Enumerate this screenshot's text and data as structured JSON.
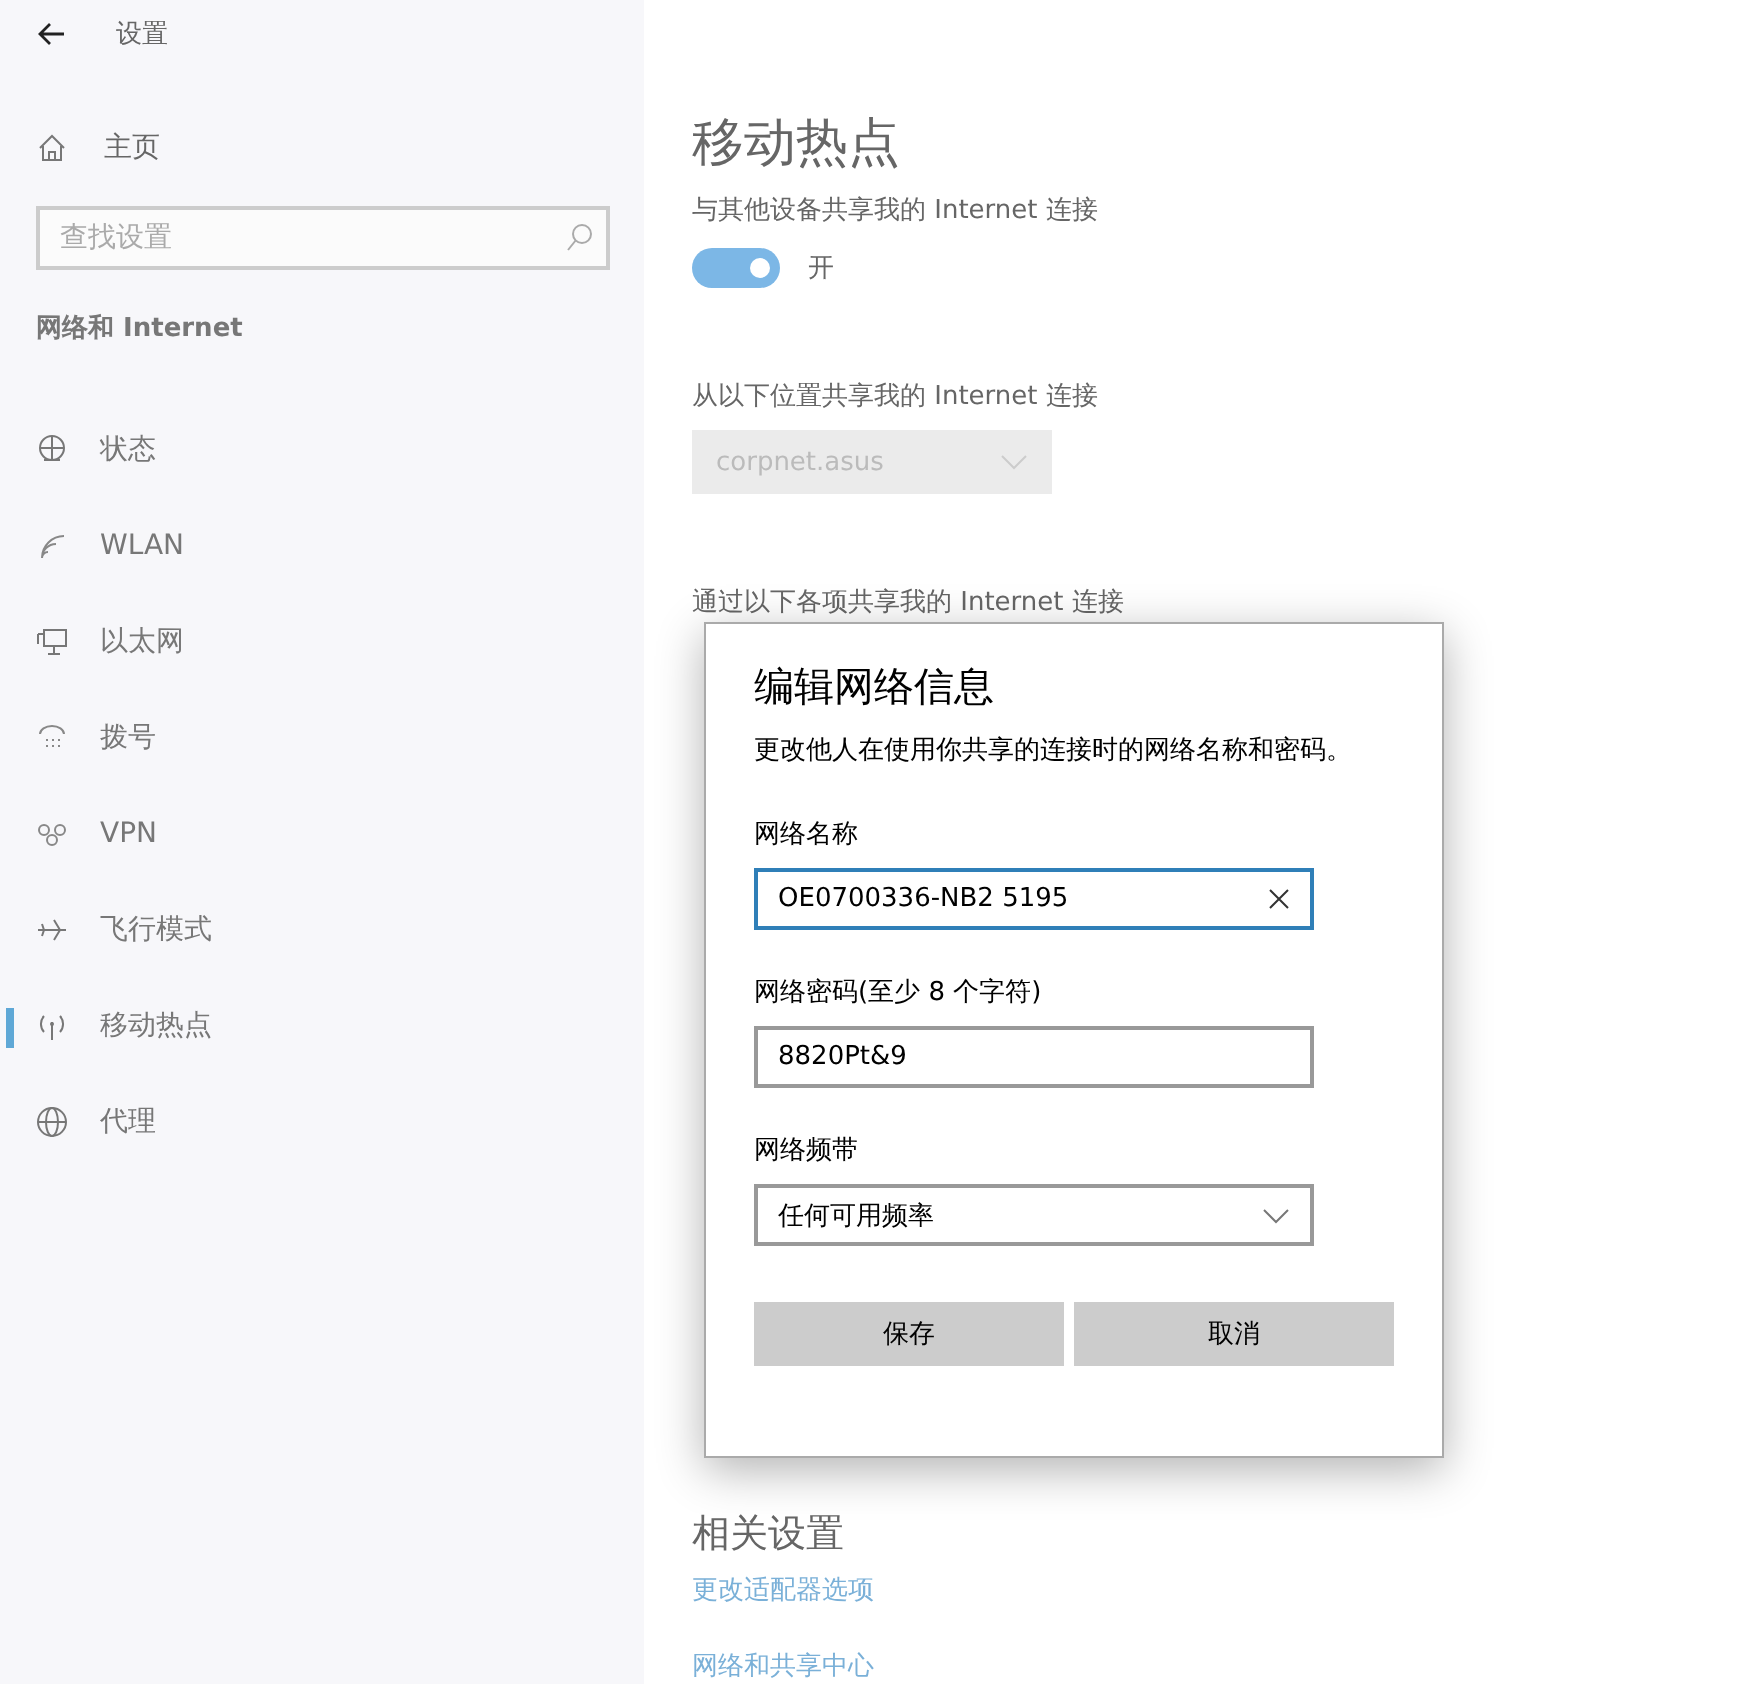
{
  "window": {
    "title": "设置"
  },
  "sidebar": {
    "home": "主页",
    "search": {
      "placeholder": "查找设置"
    },
    "section": "网络和 Internet",
    "items": [
      {
        "label": "状态",
        "selected": false
      },
      {
        "label": "WLAN",
        "selected": false
      },
      {
        "label": "以太网",
        "selected": false
      },
      {
        "label": "拨号",
        "selected": false
      },
      {
        "label": "VPN",
        "selected": false
      },
      {
        "label": "飞行模式",
        "selected": false
      },
      {
        "label": "移动热点",
        "selected": true
      },
      {
        "label": "代理",
        "selected": false
      }
    ]
  },
  "main": {
    "title": "移动热点",
    "share": {
      "label": "与其他设备共享我的 Internet 连接",
      "toggle": {
        "on": true,
        "label": "开"
      }
    },
    "source": {
      "label": "从以下位置共享我的 Internet 连接",
      "dropdown": {
        "value": "corpnet.asus",
        "disabled": true
      }
    },
    "via": {
      "label": "通过以下各项共享我的 Internet 连接"
    },
    "related": {
      "title": "相关设置",
      "links": [
        "更改适配器选项",
        "网络和共享中心"
      ]
    }
  },
  "dialog": {
    "title": "编辑网络信息",
    "description": "更改他人在使用你共享的连接时的网络名称和密码。",
    "fields": [
      {
        "kind": "text",
        "label": "网络名称",
        "value": "OE0700336-NB2 5195",
        "focused": true
      },
      {
        "kind": "text",
        "label": "网络密码(至少 8 个字符)",
        "value": "8820Pt&9",
        "focused": false
      },
      {
        "kind": "select",
        "label": "网络频带",
        "value": "任何可用频率",
        "focused": false
      }
    ],
    "buttons": [
      "保存",
      "取消"
    ]
  }
}
